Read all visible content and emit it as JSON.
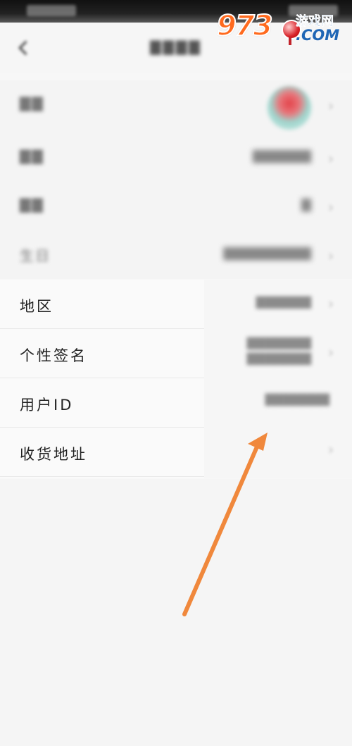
{
  "logo": {
    "number": "9",
    "number2": "73",
    "cn": "游戏网",
    "com": ".COM"
  },
  "rows_visible": [
    {
      "label": "地区"
    },
    {
      "label": "个性签名"
    },
    {
      "label": "用户ID"
    },
    {
      "label": "收货地址"
    }
  ],
  "blurred_rows": [
    {
      "label": "生日"
    }
  ],
  "colors": {
    "arrow": "#f0883c",
    "background": "#f7f7f7"
  },
  "icons": {
    "back": "chevron-left-icon",
    "chevron": "chevron-right-icon"
  }
}
